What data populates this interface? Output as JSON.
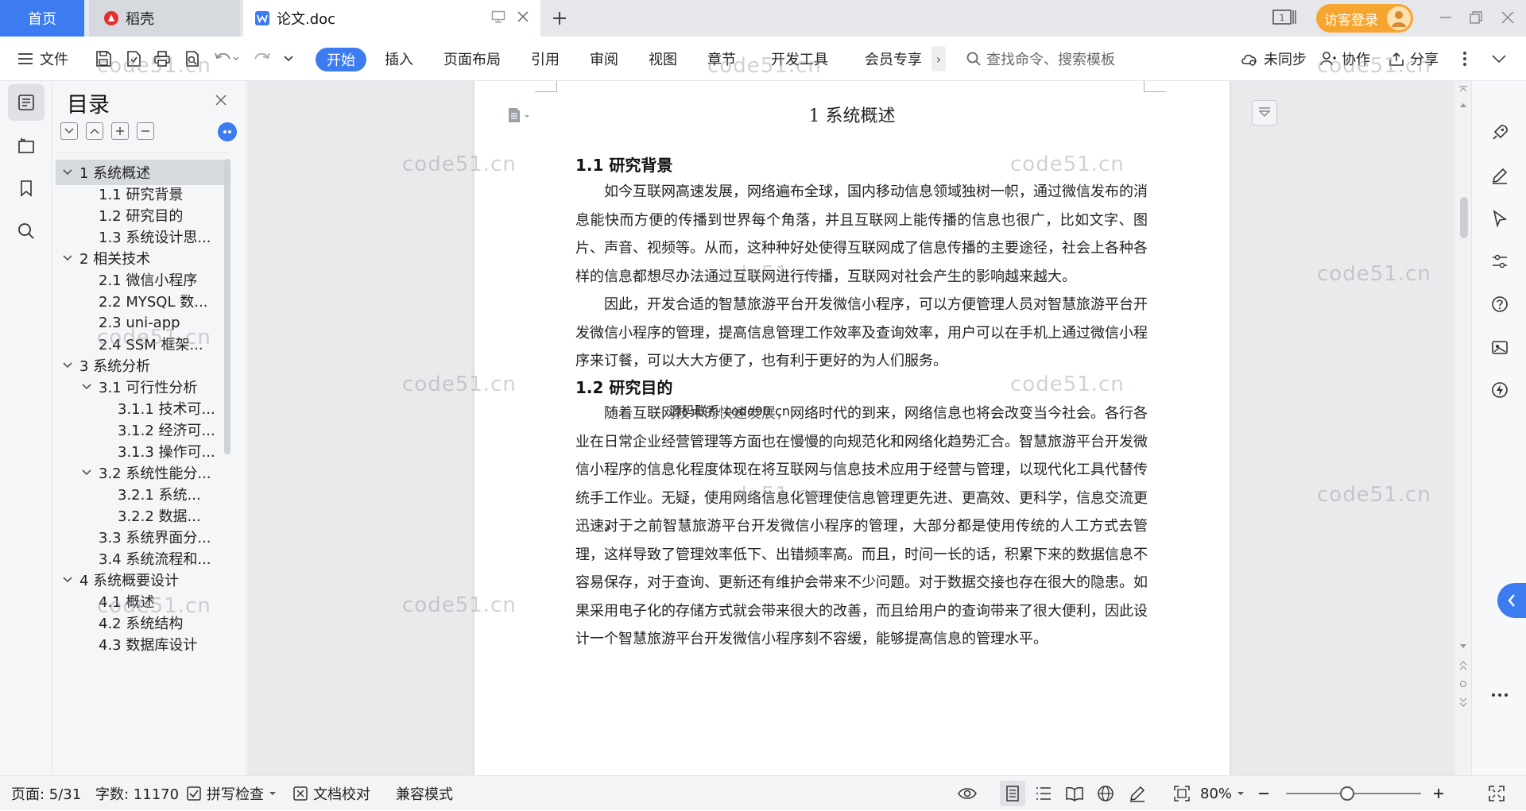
{
  "titlebar": {
    "tabs": [
      {
        "label": "首页"
      },
      {
        "label": "稻壳"
      },
      {
        "label": "论文.doc"
      }
    ],
    "new_tab": "+",
    "page_badge": "1",
    "login_label": "访客登录"
  },
  "toolbar": {
    "file_label": "文件",
    "tabs": [
      "开始",
      "插入",
      "页面布局",
      "引用",
      "审阅",
      "视图",
      "章节",
      "开发工具",
      "会员专享"
    ],
    "more_chevron": "›",
    "search_placeholder": "查找命令、搜索模板",
    "sync_label": "未同步",
    "collab_label": "协作",
    "share_label": "分享"
  },
  "toc": {
    "title": "目录",
    "items": [
      {
        "label": "1 系统概述",
        "level": 1,
        "expanded": true,
        "active": true
      },
      {
        "label": "1.1  研究背景",
        "level": 2
      },
      {
        "label": "1.2 研究目的",
        "level": 2
      },
      {
        "label": "1.3 系统设计思...",
        "level": 2
      },
      {
        "label": "2 相关技术",
        "level": 1,
        "expanded": true
      },
      {
        "label": "2.1 微信小程序",
        "level": 2
      },
      {
        "label": "2.2 MYSQL 数...",
        "level": 2
      },
      {
        "label": "2.3 uni-app",
        "level": 2
      },
      {
        "label": "2.4 SSM 框架...",
        "level": 2
      },
      {
        "label": "3 系统分析",
        "level": 1,
        "expanded": true
      },
      {
        "label": "3.1 可行性分析",
        "level": 2,
        "expanded": true
      },
      {
        "label": "3.1.1 技术可...",
        "level": 3
      },
      {
        "label": "3.1.2 经济可...",
        "level": 3
      },
      {
        "label": "3.1.3 操作可...",
        "level": 3
      },
      {
        "label": "3.2 系统性能分...",
        "level": 2,
        "expanded": true
      },
      {
        "label": "3.2.1  系统...",
        "level": 3
      },
      {
        "label": "3.2.2  数据...",
        "level": 3
      },
      {
        "label": "3.3 系统界面分...",
        "level": 2
      },
      {
        "label": "3.4 系统流程和...",
        "level": 2
      },
      {
        "label": "4 系统概要设计",
        "level": 1,
        "expanded": true
      },
      {
        "label": "4.1 概述",
        "level": 2
      },
      {
        "label": "4.2 系统结构",
        "level": 2
      },
      {
        "label": "4.3 数据库设计",
        "level": 2
      }
    ]
  },
  "document": {
    "chapter_title": "1 系统概述",
    "sections": [
      {
        "heading": "1.1  研究背景",
        "paragraphs": [
          "如今互联网高速发展，网络遍布全球，国内移动信息领域独树一帜，通过微信发布的消息能快而方便的传播到世界每个角落，并且互联网上能传播的信息也很广，比如文字、图片、声音、视频等。从而，这种种好处使得互联网成了信息传播的主要途径，社会上各种各样的信息都想尽办法通过互联网进行传播，互联网对社会产生的影响越来越大。",
          "因此，开发合适的智慧旅游平台开发微信小程序，可以方便管理人员对智慧旅游平台开发微信小程序的管理，提高信息管理工作效率及查询效率，用户可以在手机上通过微信小程序来订餐，可以大大方便了，也有利于更好的为人们服务。"
        ]
      },
      {
        "heading": "1.2 研究目的",
        "paragraphs": [
          "随着互联网技术的快速发展，网络时代的到来，网络信息也将会改变当今社会。各行各业在日常企业经营管理等方面也在慢慢的向规范化和网络化趋势汇合。智慧旅游平台开发微信小程序的信息化程度体现在将互联网与信息技术应用于经营与管理，以现代化工具代替传统手工作业。无疑，使用网络信息化管理使信息管理更先进、更高效、更科学，信息交流更迅速。",
          "对于之前智慧旅游平台开发微信小程序的管理，大部分都是使用传统的人工方式去管理，这样导致了管理效率低下、出错频率高。而且，时间一长的话，积累下来的数据信息不容易保存，对于查询、更新还有维护会带来不少问题。对于数据交接也存在很大的隐患。如果采用电子化的存储方式就会带来很大的改善，而且给用户的查询带来了很大便利，因此设计一个智慧旅游平台开发微信小程序刻不容缓，能够提高信息的管理水平。"
        ]
      }
    ],
    "overlay_text": "源码联系 code90 cn",
    "watermark": "code51.cn"
  },
  "statusbar": {
    "page_label": "页面: 5/31",
    "word_count": "字数: 11170",
    "spellcheck_label": "拼写检查",
    "doc_proof_label": "文档校对",
    "compat_label": "兼容模式",
    "zoom_value": "80%",
    "zoom_level": 0.45
  },
  "colors": {
    "accent": "#3d7bf0",
    "login_orange": "#f7a531",
    "watermark": "#969ba2"
  }
}
